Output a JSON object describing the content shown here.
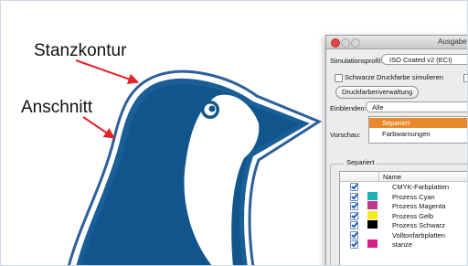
{
  "callouts": {
    "die_line": "Stanzkontur",
    "bleed": "Anschnitt"
  },
  "colors": {
    "outline_blue": "#2d5f9c",
    "penguin_dark": "#10558c",
    "penguin_light": "#ffffff",
    "arrow_red": "#e4222b",
    "highlight_orange": "#e88a2c"
  },
  "dialog": {
    "title": "Ausgabe",
    "simulation_profile_label": "Simulationsprofil:",
    "simulation_profile_value": "ISO Coated v2 (ECI)",
    "simulate_black_ink_label": "Schwarze Druckfarbe simulieren",
    "second_checkbox_label": "P",
    "ink_manager_button": "Druckfarbenverwaltung",
    "show_label": "Einblenden:",
    "show_value": "Alle",
    "preview_label": "Vorschau:",
    "preview_options": [
      "Separiert",
      "Farbwarnungen"
    ],
    "preview_selected": "Separiert",
    "separations_group_label": "Separiert",
    "table_header_name": "Name",
    "separations": [
      {
        "name": "CMYK-Farbplatten",
        "swatch": ""
      },
      {
        "name": "Prozess Cyan",
        "swatch": "#1ab2b4"
      },
      {
        "name": "Prozess Magenta",
        "swatch": "#c0398f"
      },
      {
        "name": "Prozess Gelb",
        "swatch": "#f3ea1f"
      },
      {
        "name": "Prozess Schwarz",
        "swatch": "#000000"
      },
      {
        "name": "Volltonfarbplatten",
        "swatch": ""
      },
      {
        "name": "stanze",
        "swatch": "#d9208a"
      }
    ]
  }
}
